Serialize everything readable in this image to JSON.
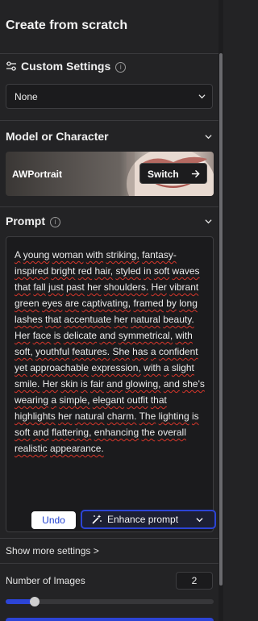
{
  "header": {
    "title": "Create from scratch"
  },
  "custom_settings": {
    "title": "Custom Settings",
    "info_icon": "info-icon",
    "select_value": "None"
  },
  "model": {
    "section_title": "Model or Character",
    "name": "AWPortrait",
    "switch_label": "Switch"
  },
  "prompt": {
    "title": "Prompt",
    "segments": [
      "A young woman with striking, ",
      "fantasy-inspired",
      " bright red ",
      "hair, styled in soft waves that fall just past her shoulders.",
      " Her ",
      "vibrant green eyes",
      " are ",
      "captivating,",
      " ",
      "framed by",
      " ",
      "long lashes",
      " ",
      "that accentuate",
      " ",
      "her natural beauty.",
      " ",
      "Her face is delicate and symmetrical,",
      " ",
      "with soft, youthful features.",
      " ",
      "She has a confident yet approachable expression,",
      " ",
      "with a slight smile.",
      " ",
      "Her skin is fair and glowing,",
      " and ",
      "she's wearing a simple, elegant outfit that highlights her natural charm.",
      " ",
      "The lighting is soft and flattering, enhancing the overall realistic appearance."
    ],
    "undo_label": "Undo",
    "enhance_label": "Enhance prompt"
  },
  "show_more_label": "Show more settings >",
  "images": {
    "label": "Number of Images",
    "value": "2",
    "slider_fraction": 0.14
  },
  "colors": {
    "accent": "#2c44d6",
    "background": "#232325",
    "field": "#1b1b1d"
  }
}
